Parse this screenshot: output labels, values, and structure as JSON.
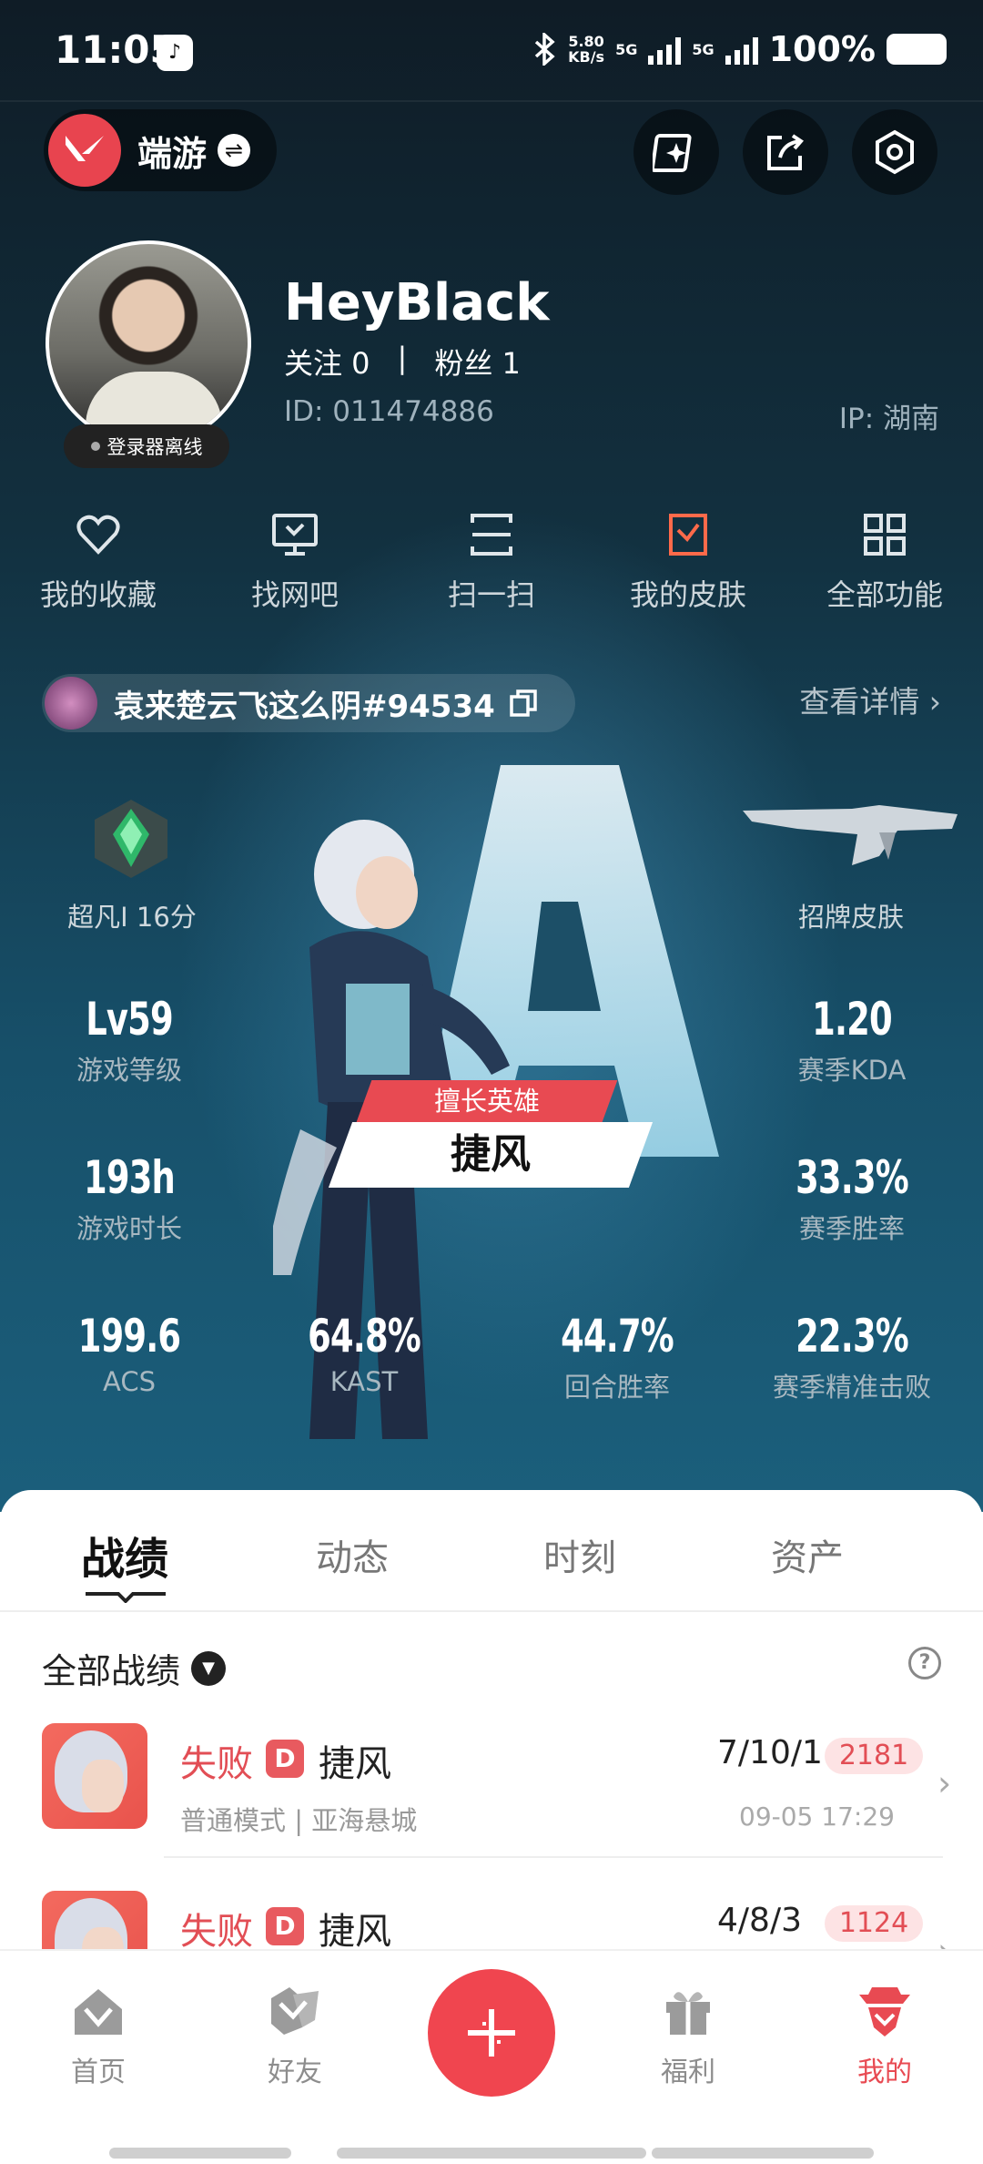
{
  "status_bar": {
    "time": "11:05",
    "net_speed_value": "5.80",
    "net_speed_unit": "KB/s",
    "sim1": "5G",
    "sim2": "5G",
    "battery": "100%"
  },
  "header": {
    "game_name": "端游",
    "buttons": [
      "sparkle-card-icon",
      "share-icon",
      "settings-icon"
    ]
  },
  "profile": {
    "username": "HeyBlack",
    "following": "关注 0",
    "separator": "|",
    "fans": "粉丝 1",
    "id": "ID:  011474886",
    "ip": "IP:  湖南",
    "status_badge": "登录器离线"
  },
  "quick_actions": [
    {
      "label": "我的收藏",
      "icon": "heart-icon"
    },
    {
      "label": "找网吧",
      "icon": "monitor-icon"
    },
    {
      "label": "扫一扫",
      "icon": "scan-icon"
    },
    {
      "label": "我的皮肤",
      "icon": "skin-icon"
    },
    {
      "label": "全部功能",
      "icon": "grid-icon"
    }
  ],
  "riot_account": {
    "riot_id": "袁来楚云飞这么阴#94534",
    "view_details": "查看详情 ›"
  },
  "stats_panel": {
    "rank": "超凡I 16分",
    "signature_skin": "招牌皮肤",
    "level_value": "Lv59",
    "level_label": "游戏等级",
    "kda_value": "1.20",
    "kda_label": "赛季KDA",
    "hours_value": "193h",
    "hours_label": "游戏时长",
    "winrate_value": "33.3%",
    "winrate_label": "赛季胜率",
    "acs_value": "199.6",
    "acs_label": "ACS",
    "kast_value": "64.8%",
    "kast_label": "KAST",
    "round_win_value": "44.7%",
    "round_win_label": "回合胜率",
    "precise_kill_value": "22.3%",
    "precise_kill_label": "赛季精准击败",
    "best_agent_tag": "擅长英雄",
    "best_agent_name": "捷风",
    "emblem_letter": "A"
  },
  "tabs": [
    "战绩",
    "动态",
    "时刻",
    "资产"
  ],
  "filter": {
    "label": "全部战绩",
    "help": "?"
  },
  "matches": [
    {
      "result": "失败",
      "badge": "D",
      "agent": "捷风",
      "mode": "普通模式 | 亚海悬城",
      "kda": "7/10/1",
      "score": "2181",
      "date": "09-05 17:29"
    },
    {
      "result": "失败",
      "badge": "D",
      "agent": "捷风",
      "mode": "",
      "kda": "4/8/3",
      "score": "1124",
      "date": ""
    }
  ],
  "bottom_nav": [
    {
      "label": "首页",
      "icon": "home-icon"
    },
    {
      "label": "好友",
      "icon": "friends-icon"
    },
    {
      "label": "福利",
      "icon": "gift-icon"
    },
    {
      "label": "我的",
      "icon": "profile-agent-icon",
      "active": true
    }
  ],
  "colors": {
    "accent": "#e84a52",
    "hero_top": "#0f1c26",
    "hero_bottom": "#1b5f7c"
  }
}
